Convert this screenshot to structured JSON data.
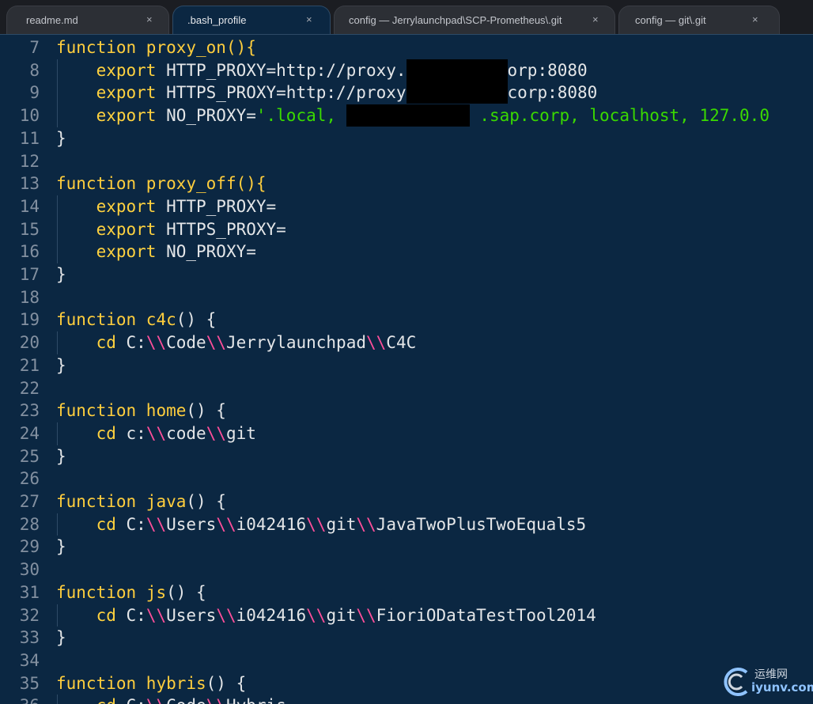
{
  "tabs": [
    {
      "label": "readme.md",
      "close": "×",
      "active": false
    },
    {
      "label": ".bash_profile",
      "close": "×",
      "active": true
    },
    {
      "label": "config — Jerrylaunchpad\\SCP-Prometheus\\.git",
      "close": "×",
      "active": false
    },
    {
      "label": "config — git\\.git",
      "close": "×",
      "active": false
    }
  ],
  "editor": {
    "lines": [
      {
        "n": "7",
        "tokens": [
          [
            "fn",
            "function "
          ],
          [
            "fn",
            "proxy_on"
          ],
          [
            "fn",
            "(){"
          ]
        ]
      },
      {
        "n": "8",
        "tokens": [
          [
            "pl",
            "    "
          ],
          [
            "kw",
            "export"
          ],
          [
            "pl",
            " HTTP_PROXY=http://proxy."
          ],
          [
            "redact",
            ""
          ],
          [
            "pl",
            "orp:8080"
          ]
        ]
      },
      {
        "n": "9",
        "tokens": [
          [
            "pl",
            "    "
          ],
          [
            "kw",
            "export"
          ],
          [
            "pl",
            " HTTPS_PROXY=http://proxy"
          ],
          [
            "redact",
            ""
          ],
          [
            "pl",
            "corp:8080"
          ]
        ]
      },
      {
        "n": "10",
        "tokens": [
          [
            "pl",
            "    "
          ],
          [
            "kw",
            "export"
          ],
          [
            "pl",
            " NO_PROXY="
          ],
          [
            "str",
            "'.local, "
          ],
          [
            "redact",
            ""
          ],
          [
            "str",
            " .sap.corp, localhost, 127.0.0"
          ]
        ]
      },
      {
        "n": "11",
        "tokens": [
          [
            "pl",
            "}"
          ]
        ]
      },
      {
        "n": "12",
        "tokens": []
      },
      {
        "n": "13",
        "tokens": [
          [
            "fn",
            "function "
          ],
          [
            "fn",
            "proxy_off"
          ],
          [
            "fn",
            "(){"
          ]
        ]
      },
      {
        "n": "14",
        "tokens": [
          [
            "pl",
            "    "
          ],
          [
            "kw",
            "export"
          ],
          [
            "pl",
            " HTTP_PROXY="
          ]
        ]
      },
      {
        "n": "15",
        "tokens": [
          [
            "pl",
            "    "
          ],
          [
            "kw",
            "export"
          ],
          [
            "pl",
            " HTTPS_PROXY="
          ]
        ]
      },
      {
        "n": "16",
        "tokens": [
          [
            "pl",
            "    "
          ],
          [
            "kw",
            "export"
          ],
          [
            "pl",
            " NO_PROXY="
          ]
        ]
      },
      {
        "n": "17",
        "tokens": [
          [
            "pl",
            "}"
          ]
        ]
      },
      {
        "n": "18",
        "tokens": []
      },
      {
        "n": "19",
        "tokens": [
          [
            "fn",
            "function "
          ],
          [
            "fn",
            "c4c"
          ],
          [
            "pl",
            "() {"
          ]
        ]
      },
      {
        "n": "20",
        "tokens": [
          [
            "pl",
            "    "
          ],
          [
            "kw",
            "cd"
          ],
          [
            "pl",
            " C:"
          ],
          [
            "esc",
            "\\\\"
          ],
          [
            "pl",
            "Code"
          ],
          [
            "esc",
            "\\\\"
          ],
          [
            "pl",
            "Jerrylaunchpad"
          ],
          [
            "esc",
            "\\\\"
          ],
          [
            "pl",
            "C4C"
          ]
        ]
      },
      {
        "n": "21",
        "tokens": [
          [
            "pl",
            "}"
          ]
        ]
      },
      {
        "n": "22",
        "tokens": []
      },
      {
        "n": "23",
        "tokens": [
          [
            "fn",
            "function "
          ],
          [
            "fn",
            "home"
          ],
          [
            "pl",
            "() {"
          ]
        ]
      },
      {
        "n": "24",
        "tokens": [
          [
            "pl",
            "    "
          ],
          [
            "kw",
            "cd"
          ],
          [
            "pl",
            " c:"
          ],
          [
            "esc",
            "\\\\"
          ],
          [
            "pl",
            "code"
          ],
          [
            "esc",
            "\\\\"
          ],
          [
            "pl",
            "git"
          ]
        ]
      },
      {
        "n": "25",
        "tokens": [
          [
            "pl",
            "}"
          ]
        ]
      },
      {
        "n": "26",
        "tokens": []
      },
      {
        "n": "27",
        "tokens": [
          [
            "fn",
            "function "
          ],
          [
            "fn",
            "java"
          ],
          [
            "pl",
            "() {"
          ]
        ]
      },
      {
        "n": "28",
        "tokens": [
          [
            "pl",
            "    "
          ],
          [
            "kw",
            "cd"
          ],
          [
            "pl",
            " C:"
          ],
          [
            "esc",
            "\\\\"
          ],
          [
            "pl",
            "Users"
          ],
          [
            "esc",
            "\\\\"
          ],
          [
            "pl",
            "i042416"
          ],
          [
            "esc",
            "\\\\"
          ],
          [
            "pl",
            "git"
          ],
          [
            "esc",
            "\\\\"
          ],
          [
            "pl",
            "JavaTwoPlusTwoEquals5"
          ]
        ]
      },
      {
        "n": "29",
        "tokens": [
          [
            "pl",
            "}"
          ]
        ]
      },
      {
        "n": "30",
        "tokens": []
      },
      {
        "n": "31",
        "tokens": [
          [
            "fn",
            "function "
          ],
          [
            "fn",
            "js"
          ],
          [
            "pl",
            "() {"
          ]
        ]
      },
      {
        "n": "32",
        "tokens": [
          [
            "pl",
            "    "
          ],
          [
            "kw",
            "cd"
          ],
          [
            "pl",
            " C:"
          ],
          [
            "esc",
            "\\\\"
          ],
          [
            "pl",
            "Users"
          ],
          [
            "esc",
            "\\\\"
          ],
          [
            "pl",
            "i042416"
          ],
          [
            "esc",
            "\\\\"
          ],
          [
            "pl",
            "git"
          ],
          [
            "esc",
            "\\\\"
          ],
          [
            "pl",
            "FioriODataTestTool2014"
          ]
        ]
      },
      {
        "n": "33",
        "tokens": [
          [
            "pl",
            "}"
          ]
        ]
      },
      {
        "n": "34",
        "tokens": []
      },
      {
        "n": "35",
        "tokens": [
          [
            "fn",
            "function "
          ],
          [
            "fn",
            "hybris"
          ],
          [
            "pl",
            "() {"
          ]
        ]
      },
      {
        "n": "36",
        "tokens": [
          [
            "pl",
            "    "
          ],
          [
            "kw",
            "cd"
          ],
          [
            "pl",
            " C:"
          ],
          [
            "esc",
            "\\\\"
          ],
          [
            "pl",
            "Code"
          ],
          [
            "esc",
            "\\\\"
          ],
          [
            "pl",
            "Hybris"
          ]
        ]
      }
    ]
  },
  "watermark": {
    "top": "运维网",
    "bottom": "iyunv.com"
  },
  "colors": {
    "background": "#0b2742",
    "keyword": "#ffce3d",
    "string": "#3ad900",
    "escape": "#ff4f9a",
    "plain": "#e4e6e8",
    "line_number": "#8390a0"
  }
}
